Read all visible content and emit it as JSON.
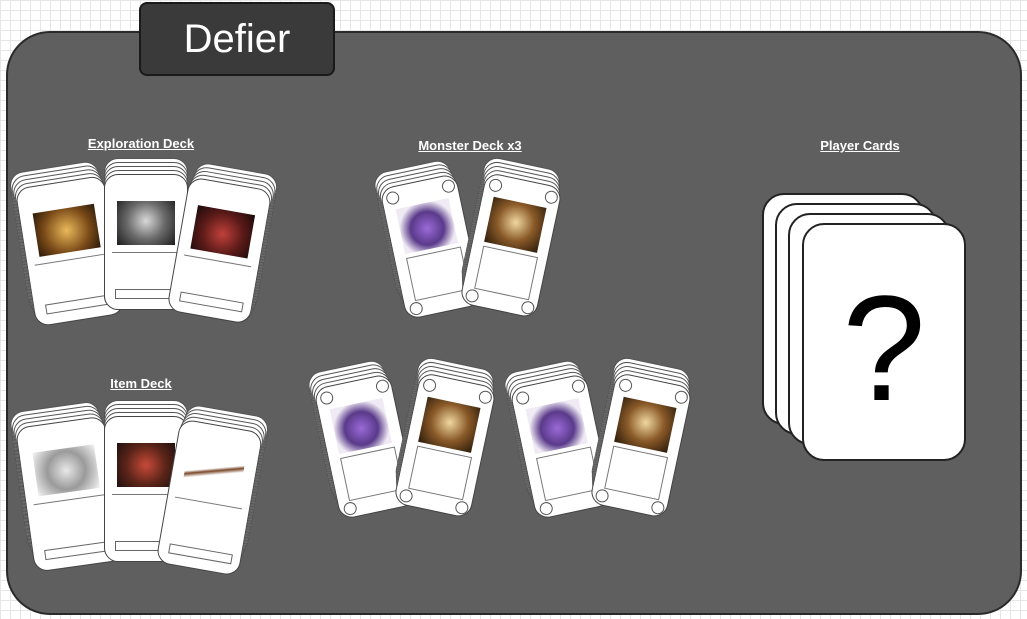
{
  "title": "Defier",
  "sections": {
    "exploration": "Exploration Deck",
    "monster": "Monster Deck x3",
    "player": "Player Cards",
    "item": "Item Deck"
  },
  "player_card_symbol": "?",
  "colors": {
    "board": "#5f5f5f",
    "title_tab": "#3a3a3a",
    "card": "#ffffff",
    "label": "#ffffff"
  }
}
